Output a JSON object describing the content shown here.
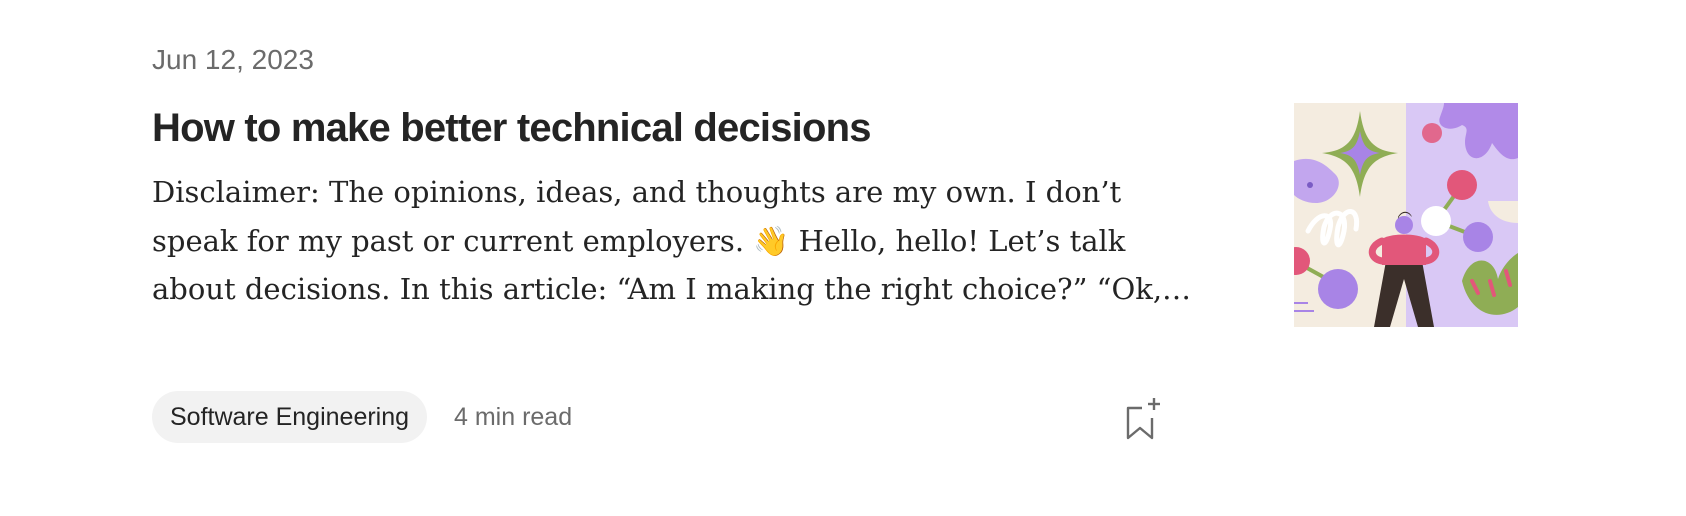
{
  "post": {
    "date": "Jun 12, 2023",
    "title": "How to make better technical decisions",
    "excerpt": "Disclaimer: The opinions, ideas, and thoughts are my own. I don’t speak for my past or current employers. 👋 Hello, hello! Let’s talk about decisions. In this article: “Am I making the right choice?” “Ok, what’s…",
    "tag": "Software Engineering",
    "read_time": "4 min read"
  },
  "icons": {
    "bookmark": "bookmark-add-icon",
    "thumbnail": "abstract-illustration"
  },
  "colors": {
    "text_primary": "#242424",
    "text_secondary": "#6b6b6b",
    "tag_background": "#f2f2f2"
  }
}
